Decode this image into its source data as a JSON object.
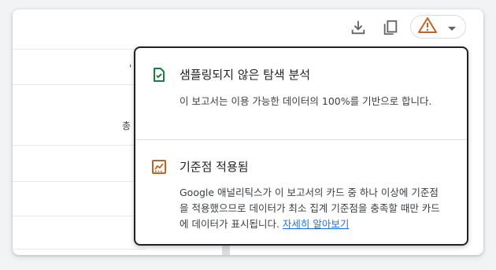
{
  "toolbar": {
    "download_icon": "download-icon",
    "copy_icon": "copy-icon",
    "warning_icon": "warning-icon",
    "caret_icon": "caret-down-icon"
  },
  "background": {
    "header_glyph": "'",
    "row_label": "총"
  },
  "popup": {
    "sampling": {
      "icon": "checked-document-icon",
      "icon_color": "#188038",
      "title": "샘플링되지 않은 탐색 분석",
      "body": "이 보고서는 이용 가능한 데이터의 100%를 기반으로 합니다."
    },
    "threshold": {
      "icon": "threshold-chart-icon",
      "icon_color": "#c5621f",
      "title": "기준점 적용됨",
      "body": "Google 애널리틱스가 이 보고서의 카드 중 하나 이상에 기준점을 적용했으므로 데이터가 최소 집계 기준점을 충족할 때만 카드에 데이터가 표시됩니다. ",
      "link": "자세히 알아보기"
    }
  },
  "colors": {
    "warning": "#c5621f",
    "link": "#1a73e8",
    "border": "#202124"
  }
}
